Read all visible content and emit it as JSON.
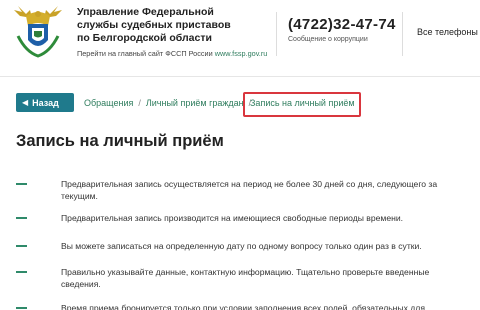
{
  "header": {
    "org_name_line1": "Управление Федеральной",
    "org_name_line2": "службы судебных приставов",
    "org_name_line3": "по Белгородской области",
    "main_site_prefix": "Перейти на главный сайт ФССП России",
    "main_site_link": "www.fssp.gov.ru",
    "phone": "(4722)32-47-74",
    "phone_caption": "Сообщение о коррупции",
    "all_phones": "Все телефоны"
  },
  "breadcrumbs": {
    "back_label": "Назад",
    "items": [
      "Обращения",
      "Личный приём граждан"
    ],
    "current": "Запись на личный приём"
  },
  "page": {
    "title": "Запись на личный приём"
  },
  "rules": [
    "Предварительная запись осуществляется на период не более 30 дней со дня, следующего за текущим.",
    "Предварительная запись производится на имеющиеся свободные периоды времени.",
    "Вы можете записаться на определенную дату по одному вопросу только один раз в сутки.",
    "Правильно указывайте данные, контактную информацию. Тщательно проверьте введенные сведения.",
    "Время приема бронируется только при условии заполнения всех полей, обязательных для"
  ],
  "colors": {
    "accent": "#1f7a8c",
    "link": "#2f7d5e",
    "highlight": "#d9363e"
  }
}
